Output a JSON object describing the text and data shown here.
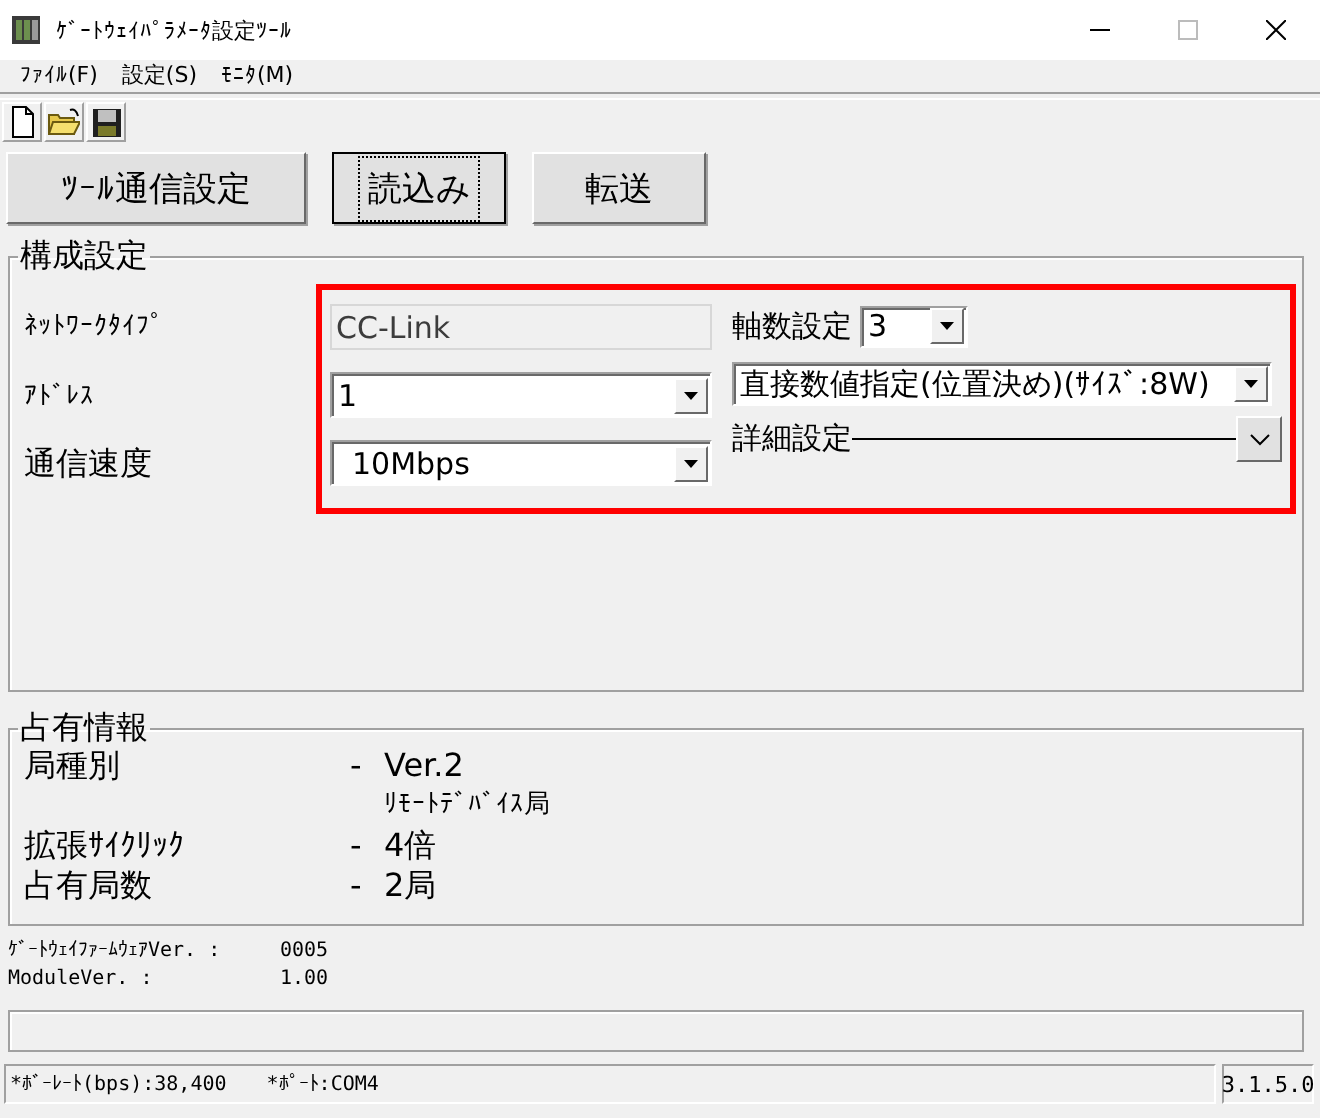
{
  "window": {
    "title": "ｹﾞｰﾄｳｪｲﾊﾟﾗﾒｰﾀ設定ﾂｰﾙ"
  },
  "menu": [
    {
      "label": "ﾌｧｲﾙ(F)"
    },
    {
      "label": "設定(S)"
    },
    {
      "label": "ﾓﾆﾀ(M)"
    }
  ],
  "toolbar": [
    {
      "kind": "new"
    },
    {
      "kind": "open"
    },
    {
      "kind": "save"
    }
  ],
  "buttons": [
    {
      "label": "ﾂｰﾙ通信設定",
      "focused": false
    },
    {
      "label": "読込み",
      "focused": true
    },
    {
      "label": "転送",
      "focused": false
    }
  ],
  "config": {
    "title": "構成設定",
    "highlight": true,
    "network_type": {
      "label": "ﾈｯﾄﾜｰｸﾀｲﾌﾟ",
      "value": "CC-Link",
      "disabled": true
    },
    "address": {
      "label": "ｱﾄﾞﾚｽ",
      "value": "1"
    },
    "speed": {
      "label": "通信速度",
      "value": "10Mbps"
    },
    "axes": {
      "label": "軸数設定",
      "value": "3"
    },
    "mode": {
      "value": "直接数値指定(位置決め)(ｻｲｽﾞ:8W)"
    },
    "details": {
      "label": "詳細設定",
      "expanded": false
    }
  },
  "occupancy": {
    "title": "占有情報",
    "rows": [
      {
        "label": "局種別",
        "dash": "-",
        "values": [
          "Ver.2",
          "ﾘﾓｰﾄﾃﾞﾊﾞｲｽ局"
        ]
      },
      {
        "label": "拡張ｻｲｸﾘｯｸ",
        "dash": "-",
        "values": [
          "4倍"
        ]
      },
      {
        "label": "占有局数",
        "dash": "-",
        "values": [
          "2局"
        ]
      }
    ]
  },
  "versions": [
    {
      "label": "ｹﾞｰﾄｳｪｲﾌｧｰﾑｳｪｱVer. :",
      "value": "0005"
    },
    {
      "label": "ModuleVer. :",
      "value": "1.00"
    }
  ],
  "status_bar": {
    "baud": "*ﾎﾞｰﾚｰﾄ(bps):38,400",
    "port": "*ﾎﾟｰﾄ:COM4",
    "version": "3.1.5.0"
  }
}
